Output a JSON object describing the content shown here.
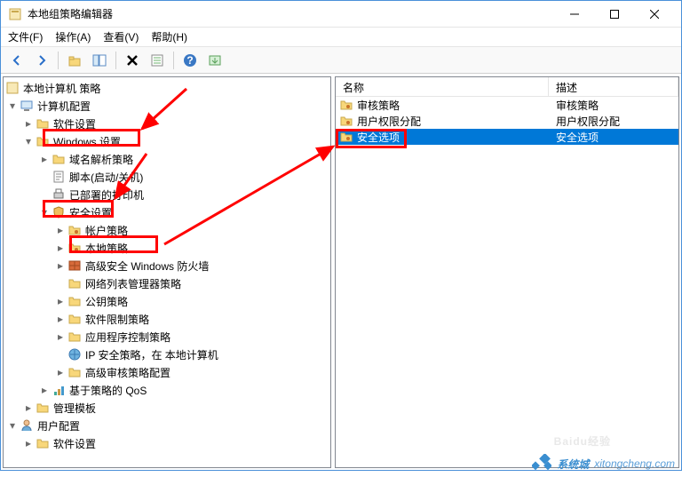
{
  "window": {
    "title": "本地组策略编辑器"
  },
  "menus": [
    "文件(F)",
    "操作(A)",
    "查看(V)",
    "帮助(H)"
  ],
  "toolbar_icons": [
    "back",
    "forward",
    "up",
    "show-hide-tree",
    "delete",
    "properties",
    "help",
    "export"
  ],
  "tree": {
    "root": {
      "label": "本地计算机 策略",
      "icon": "console"
    },
    "n1": {
      "label": "计算机配置",
      "icon": "computer"
    },
    "n1_1": {
      "label": "软件设置",
      "icon": "folder"
    },
    "n1_2": {
      "label": "Windows 设置",
      "icon": "folder"
    },
    "n1_2_1": {
      "label": "域名解析策略",
      "icon": "folder"
    },
    "n1_2_2": {
      "label": "脚本(启动/关机)",
      "icon": "script"
    },
    "n1_2_3": {
      "label": "已部署的打印机",
      "icon": "printer"
    },
    "n1_2_4": {
      "label": "安全设置",
      "icon": "shield"
    },
    "n1_2_4_1": {
      "label": "帐户策略",
      "icon": "key-folder"
    },
    "n1_2_4_2": {
      "label": "本地策略",
      "icon": "key-folder"
    },
    "n1_2_4_3": {
      "label": "高级安全 Windows 防火墙",
      "icon": "firewall"
    },
    "n1_2_4_4": {
      "label": "网络列表管理器策略",
      "icon": "folder"
    },
    "n1_2_4_5": {
      "label": "公钥策略",
      "icon": "folder"
    },
    "n1_2_4_6": {
      "label": "软件限制策略",
      "icon": "folder"
    },
    "n1_2_4_7": {
      "label": "应用程序控制策略",
      "icon": "folder"
    },
    "n1_2_4_8": {
      "label": "IP 安全策略，在 本地计算机",
      "icon": "ipsec"
    },
    "n1_2_4_9": {
      "label": "高级审核策略配置",
      "icon": "folder"
    },
    "n1_2_5": {
      "label": "基于策略的 QoS",
      "icon": "qos"
    },
    "n1_3": {
      "label": "管理模板",
      "icon": "folder"
    },
    "n2": {
      "label": "用户配置",
      "icon": "user"
    },
    "n2_1": {
      "label": "软件设置",
      "icon": "folder"
    }
  },
  "columns": {
    "name": "名称",
    "desc": "描述"
  },
  "rows": [
    {
      "name": "审核策略",
      "desc": "审核策略",
      "icon": "key-folder"
    },
    {
      "name": "用户权限分配",
      "desc": "用户权限分配",
      "icon": "key-folder"
    },
    {
      "name": "安全选项",
      "desc": "安全选项",
      "icon": "key-folder",
      "selected": true
    }
  ],
  "watermark": {
    "baidu": "Baidu经验",
    "site": "xitongcheng.com",
    "site_label": "系统城"
  }
}
